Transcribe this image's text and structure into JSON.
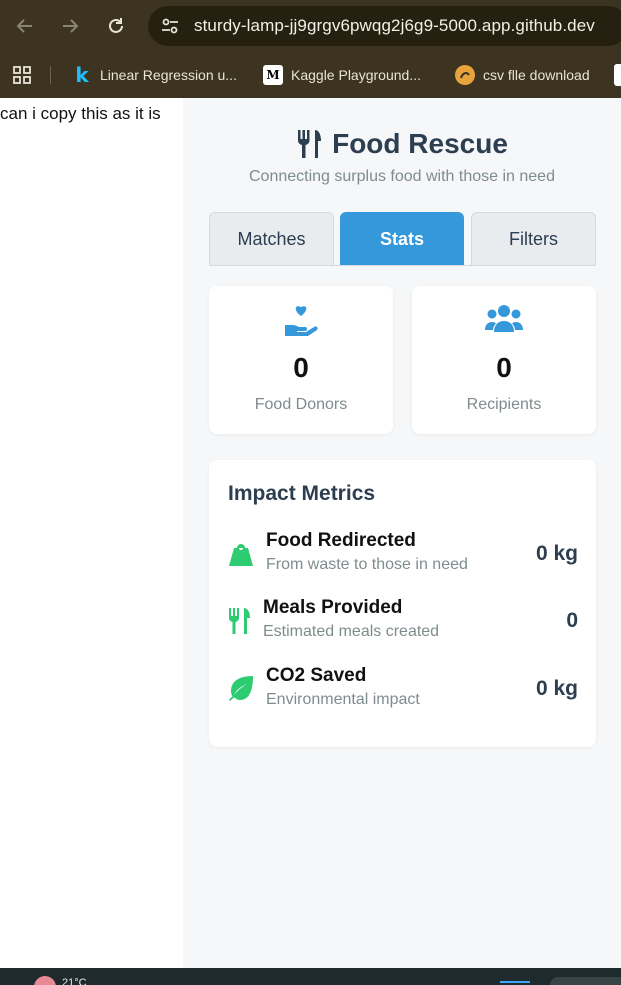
{
  "browser": {
    "url": "sturdy-lamp-jj9grgv6pwqg2j6g9-5000.app.github.dev",
    "bookmarks": [
      {
        "label": "Linear Regression u...",
        "favicon": "k"
      },
      {
        "label": "Kaggle Playground...",
        "favicon": "M"
      },
      {
        "label": "csv flle download",
        "favicon": "csv-icon"
      }
    ]
  },
  "page": {
    "left_text": "can i copy this as it is"
  },
  "app": {
    "title": "Food Rescue",
    "subtitle": "Connecting surplus food with those in need",
    "tabs": [
      {
        "label": "Matches",
        "active": false
      },
      {
        "label": "Stats",
        "active": true
      },
      {
        "label": "Filters",
        "active": false
      }
    ],
    "stats": [
      {
        "icon": "hand-heart-icon",
        "value": "0",
        "label": "Food Donors"
      },
      {
        "icon": "users-icon",
        "value": "0",
        "label": "Recipients"
      }
    ],
    "impact": {
      "title": "Impact Metrics",
      "metrics": [
        {
          "icon": "weight-icon",
          "name": "Food Redirected",
          "desc": "From waste to those in need",
          "value": "0 kg"
        },
        {
          "icon": "utensils-icon",
          "name": "Meals Provided",
          "desc": "Estimated meals created",
          "value": "0"
        },
        {
          "icon": "leaf-icon",
          "name": "CO2 Saved",
          "desc": "Environmental impact",
          "value": "0 kg"
        }
      ]
    }
  },
  "taskbar": {
    "temperature": "21°C"
  },
  "colors": {
    "accent": "#3498db",
    "metric_green": "#2ecc71",
    "heading": "#2c3e50",
    "muted": "#7f8c8d"
  }
}
